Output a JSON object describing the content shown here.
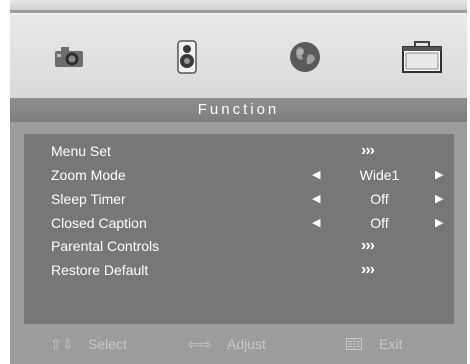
{
  "menu": {
    "title": "Function",
    "icons": [
      "camera-icon",
      "speaker-icon",
      "globe-icon",
      "toolbox-icon"
    ],
    "items": [
      {
        "label": "Menu Set",
        "type": "submenu",
        "indicator": "›››"
      },
      {
        "label": "Zoom Mode",
        "type": "option",
        "value": "Wide1"
      },
      {
        "label": "Sleep Timer",
        "type": "option",
        "value": "Off"
      },
      {
        "label": "Closed Caption",
        "type": "option",
        "value": "Off"
      },
      {
        "label": "Parental Controls",
        "type": "submenu",
        "indicator": "›››"
      },
      {
        "label": "Restore Default",
        "type": "submenu",
        "indicator": "›››"
      }
    ]
  },
  "footer": {
    "select_icon": "⇧⇩",
    "select_label": "Select",
    "adjust_icon": "⇦⇨",
    "adjust_label": "Adjust",
    "exit_label": "Exit"
  },
  "colors": {
    "osd_background": "#9c9c9c",
    "panel": "#777777",
    "title_bar": "#868686",
    "text": "#ffffff",
    "footer_text": "#c8c8c8"
  }
}
